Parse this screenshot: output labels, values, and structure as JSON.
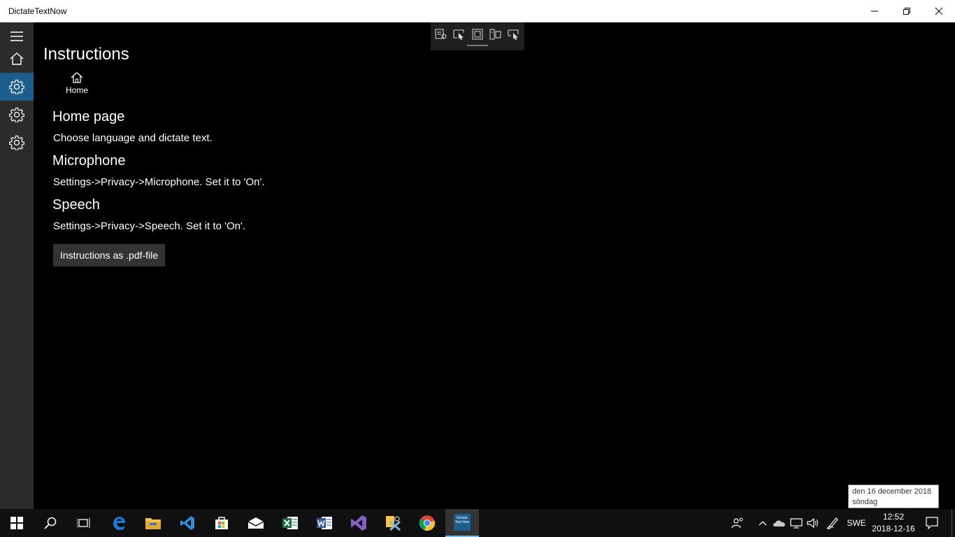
{
  "window": {
    "title": "DictateTextNow"
  },
  "page": {
    "title": "Instructions",
    "home_label": "Home"
  },
  "sections": [
    {
      "heading": "Home page",
      "text": "Choose language and dictate text."
    },
    {
      "heading": "Microphone",
      "text": "Settings->Privacy->Microphone. Set it to 'On'."
    },
    {
      "heading": "Speech",
      "text": "Settings->Privacy->Speech. Set it to 'On'."
    }
  ],
  "pdf_button_label": "Instructions as .pdf-file",
  "nav": {
    "items": [
      {
        "icon": "hamburger-icon"
      },
      {
        "icon": "home-icon"
      },
      {
        "icon": "gear-icon",
        "selected": true
      },
      {
        "icon": "gear-icon"
      },
      {
        "icon": "gear-icon"
      }
    ]
  },
  "tooltip": {
    "line1": "den 16 december 2018",
    "line2": "söndag"
  },
  "taskbar": {
    "apps": [
      "start-icon",
      "search-icon",
      "task-view-icon",
      "edge-icon",
      "file-explorer-icon",
      "vscode-icon",
      "store-icon",
      "mail-icon",
      "excel-icon",
      "word-icon",
      "visual-studio-icon",
      "tools-icon",
      "chrome-icon",
      "dictatetextnow-icon"
    ],
    "app_tile_text": "Dictate Text Now",
    "language": "SWE",
    "time": "12:52",
    "date": "2018-12-16"
  },
  "colors": {
    "accent": "#1c5d8c",
    "nav_bg": "#2b2b2b",
    "content_bg": "#000000"
  }
}
